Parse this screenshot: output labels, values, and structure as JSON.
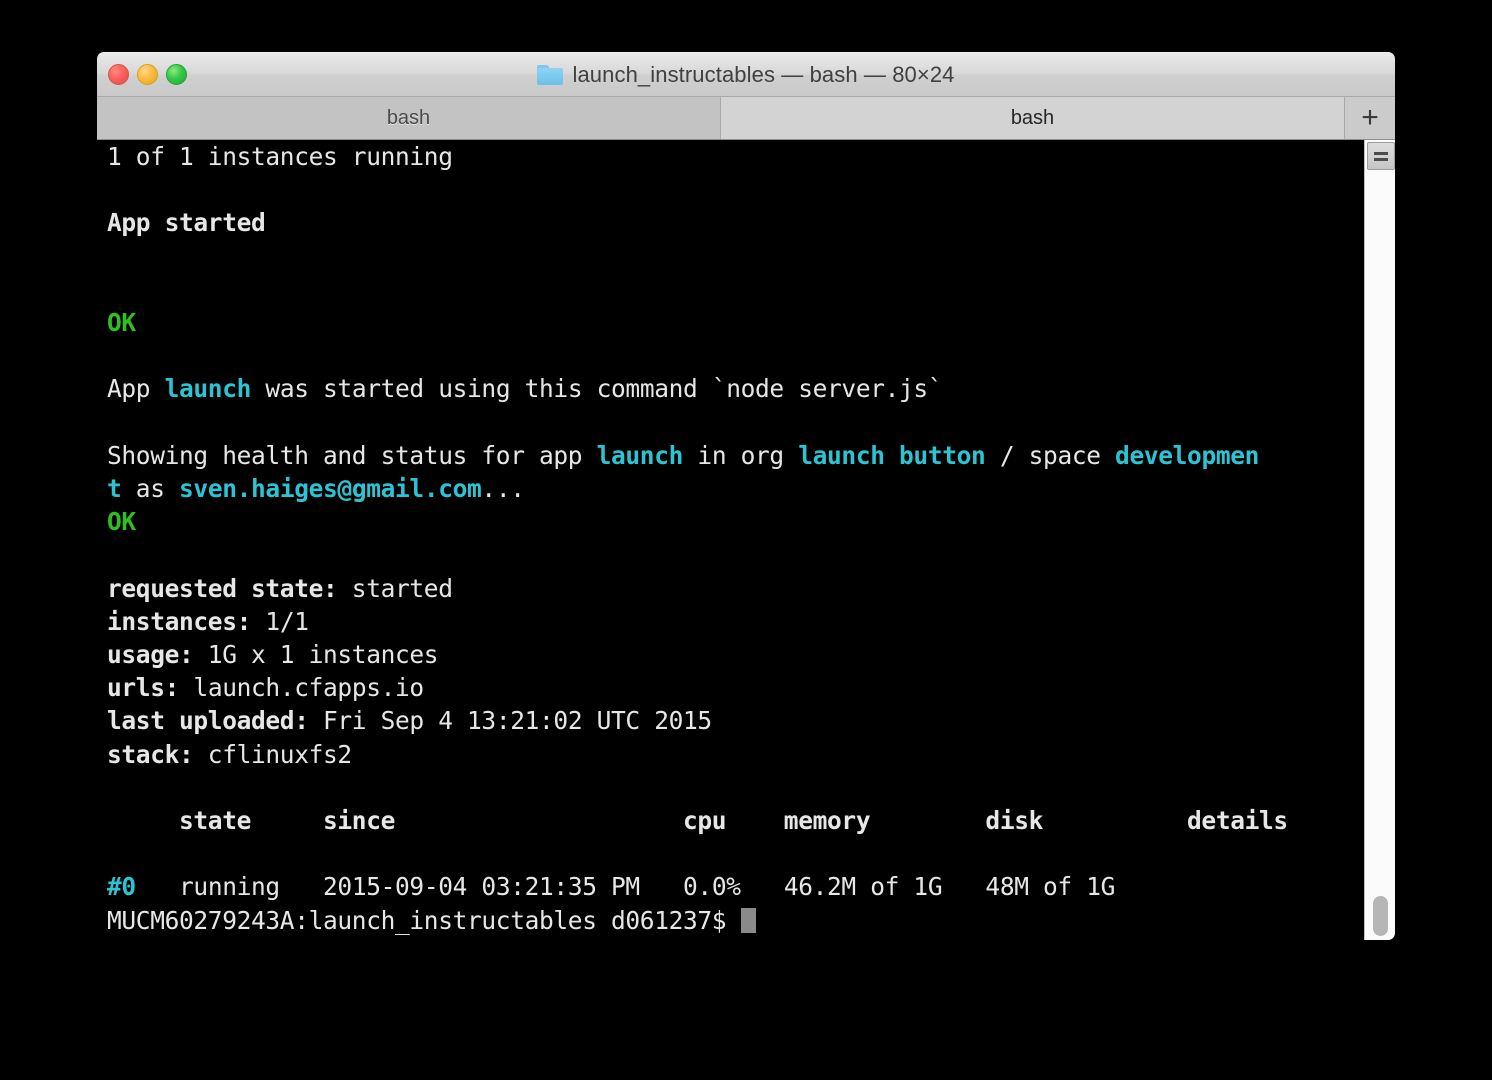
{
  "window": {
    "title": "launch_instructables — bash — 80×24",
    "folder_icon": "folder-icon",
    "traffic_lights": [
      {
        "name": "close",
        "color": "#fb605c"
      },
      {
        "name": "minimize",
        "color": "#fcbb40"
      },
      {
        "name": "zoom",
        "color": "#34c749"
      }
    ]
  },
  "tabs": {
    "items": [
      {
        "label": "bash",
        "state": "inactive"
      },
      {
        "label": "bash",
        "state": "active"
      }
    ],
    "new_tab_label": "+"
  },
  "terminal": {
    "colors": {
      "background": "#000000",
      "foreground": "#e7e7e7",
      "cyan": "#2bc4d4",
      "green": "#2fbf1f",
      "cursor": "#8a8a8a"
    },
    "lines": [
      {
        "id": "line-instances-running",
        "segments": [
          {
            "text": "1 of 1 instances running",
            "style": "plain"
          }
        ]
      },
      {
        "id": "line-blank-1",
        "segments": [
          {
            "text": "",
            "style": "plain"
          }
        ]
      },
      {
        "id": "line-app-started",
        "segments": [
          {
            "text": "App started",
            "style": "bold"
          }
        ]
      },
      {
        "id": "line-blank-2",
        "segments": [
          {
            "text": "",
            "style": "plain"
          }
        ]
      },
      {
        "id": "line-blank-3",
        "segments": [
          {
            "text": "",
            "style": "plain"
          }
        ]
      },
      {
        "id": "line-ok-1",
        "segments": [
          {
            "text": "OK",
            "style": "green"
          }
        ]
      },
      {
        "id": "line-blank-4",
        "segments": [
          {
            "text": "",
            "style": "plain"
          }
        ]
      },
      {
        "id": "line-app-launch-command",
        "segments": [
          {
            "text": "App ",
            "style": "plain"
          },
          {
            "text": "launch",
            "style": "cyan"
          },
          {
            "text": " was started using this command `node server.js`",
            "style": "plain"
          }
        ]
      },
      {
        "id": "line-blank-5",
        "segments": [
          {
            "text": "",
            "style": "plain"
          }
        ]
      },
      {
        "id": "line-showing-health-1",
        "segments": [
          {
            "text": "Showing health and status for app ",
            "style": "plain"
          },
          {
            "text": "launch",
            "style": "cyan"
          },
          {
            "text": " in org ",
            "style": "plain"
          },
          {
            "text": "launch button",
            "style": "cyan"
          },
          {
            "text": " / space ",
            "style": "plain"
          },
          {
            "text": "developmen",
            "style": "cyan"
          }
        ]
      },
      {
        "id": "line-showing-health-2",
        "segments": [
          {
            "text": "t",
            "style": "cyan"
          },
          {
            "text": " as ",
            "style": "plain"
          },
          {
            "text": "sven.haiges@gmail.com",
            "style": "cyan"
          },
          {
            "text": "...",
            "style": "plain"
          }
        ]
      },
      {
        "id": "line-ok-2",
        "segments": [
          {
            "text": "OK",
            "style": "green"
          }
        ]
      },
      {
        "id": "line-blank-6",
        "segments": [
          {
            "text": "",
            "style": "plain"
          }
        ]
      },
      {
        "id": "line-requested-state",
        "segments": [
          {
            "text": "requested state:",
            "style": "bold"
          },
          {
            "text": " started",
            "style": "plain"
          }
        ]
      },
      {
        "id": "line-instances",
        "segments": [
          {
            "text": "instances:",
            "style": "bold"
          },
          {
            "text": " 1/1",
            "style": "plain"
          }
        ]
      },
      {
        "id": "line-usage",
        "segments": [
          {
            "text": "usage:",
            "style": "bold"
          },
          {
            "text": " 1G x 1 instances",
            "style": "plain"
          }
        ]
      },
      {
        "id": "line-urls",
        "segments": [
          {
            "text": "urls:",
            "style": "bold"
          },
          {
            "text": " launch.cfapps.io",
            "style": "plain"
          }
        ]
      },
      {
        "id": "line-last-uploaded",
        "segments": [
          {
            "text": "last uploaded:",
            "style": "bold"
          },
          {
            "text": " Fri Sep 4 13:21:02 UTC 2015",
            "style": "plain"
          }
        ]
      },
      {
        "id": "line-stack",
        "segments": [
          {
            "text": "stack:",
            "style": "bold"
          },
          {
            "text": " cflinuxfs2",
            "style": "plain"
          }
        ]
      },
      {
        "id": "line-blank-7",
        "segments": [
          {
            "text": "",
            "style": "plain"
          }
        ]
      },
      {
        "id": "line-table-header",
        "segments": [
          {
            "text": "     state     since                    cpu    memory        disk          details",
            "style": "bold"
          }
        ]
      },
      {
        "id": "line-blank-8",
        "segments": [
          {
            "text": "",
            "style": "plain"
          }
        ]
      },
      {
        "id": "line-instance-row-0",
        "segments": [
          {
            "text": "#0",
            "style": "cyan"
          },
          {
            "text": "   running   2015-09-04 03:21:35 PM   0.0%   46.2M of 1G   48M of 1G",
            "style": "plain"
          }
        ]
      },
      {
        "id": "line-prompt",
        "segments": [
          {
            "text": "MUCM60279243A:launch_instructables d061237$ ",
            "style": "plain"
          },
          {
            "text": "",
            "style": "cursor"
          }
        ]
      }
    ],
    "status_table": {
      "columns": [
        "",
        "state",
        "since",
        "cpu",
        "memory",
        "disk",
        "details"
      ],
      "rows": [
        {
          "index": "#0",
          "state": "running",
          "since": "2015-09-04 03:21:35 PM",
          "cpu": "0.0%",
          "memory": "46.2M of 1G",
          "disk": "48M of 1G",
          "details": ""
        }
      ]
    },
    "app_summary": {
      "requested_state": "started",
      "instances": "1/1",
      "usage": "1G x 1 instances",
      "urls": "launch.cfapps.io",
      "last_uploaded": "Fri Sep 4 13:21:02 UTC 2015",
      "stack": "cflinuxfs2",
      "app_name": "launch",
      "org": "launch button",
      "space": "development",
      "user": "sven.haiges@gmail.com",
      "start_command": "node server.js"
    },
    "prompt": {
      "host": "MUCM60279243A",
      "directory": "launch_instructables",
      "user": "d061237",
      "symbol": "$"
    }
  },
  "scrollbar": {
    "marks_button_label": "marks-icon"
  }
}
